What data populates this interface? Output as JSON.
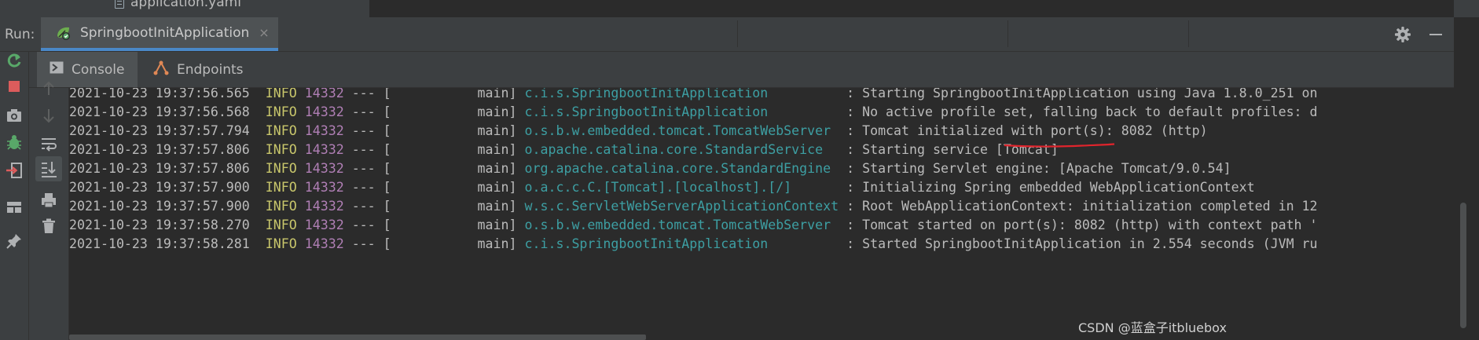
{
  "file_tree": {
    "file_name": "application.yaml"
  },
  "run_header": {
    "label": "Run:",
    "tab_label": "SpringbootInitApplication",
    "close_glyph": "×",
    "actions": [
      "gear-icon",
      "minimize-icon"
    ]
  },
  "subtabs": [
    {
      "label": "Console",
      "icon": "console-icon",
      "active": true
    },
    {
      "label": "Endpoints",
      "icon": "endpoints-icon",
      "active": false
    }
  ],
  "left_toolbar": [
    "rerun-icon",
    "stop-icon",
    "camera-icon",
    "debug-icon",
    "login-icon",
    "layout-icon",
    "pin-icon"
  ],
  "console_toolbar": [
    "up-arrow-icon",
    "down-arrow-icon",
    "soft-wrap-icon",
    "scroll-to-end-icon",
    "print-icon",
    "trash-icon"
  ],
  "colors": {
    "background": "#2b2b2b",
    "panel": "#3c3f41",
    "level": "#c8c66b",
    "pid": "#b07fb5",
    "logger": "#3d9fa3",
    "accent": "#4a88c7",
    "annotation": "#e0242c"
  },
  "log_lines": [
    {
      "time": "2021-10-23 19:37:56.565",
      "level": "INFO",
      "pid": "14332",
      "sep": "--- [",
      "thread": "           main]",
      "logger": "c.i.s.SpringbootInitApplication          ",
      "msg": ": Starting SpringbootInitApplication using Java 1.8.0_251 on"
    },
    {
      "time": "2021-10-23 19:37:56.568",
      "level": "INFO",
      "pid": "14332",
      "sep": "--- [",
      "thread": "           main]",
      "logger": "c.i.s.SpringbootInitApplication          ",
      "msg": ": No active profile set, falling back to default profiles: d"
    },
    {
      "time": "2021-10-23 19:37:57.794",
      "level": "INFO",
      "pid": "14332",
      "sep": "--- [",
      "thread": "           main]",
      "logger": "o.s.b.w.embedded.tomcat.TomcatWebServer  ",
      "msg": ": Tomcat initialized with port(s): 8082 (http)"
    },
    {
      "time": "2021-10-23 19:37:57.806",
      "level": "INFO",
      "pid": "14332",
      "sep": "--- [",
      "thread": "           main]",
      "logger": "o.apache.catalina.core.StandardService   ",
      "msg": ": Starting service [Tomcat]"
    },
    {
      "time": "2021-10-23 19:37:57.806",
      "level": "INFO",
      "pid": "14332",
      "sep": "--- [",
      "thread": "           main]",
      "logger": "org.apache.catalina.core.StandardEngine  ",
      "msg": ": Starting Servlet engine: [Apache Tomcat/9.0.54]"
    },
    {
      "time": "2021-10-23 19:37:57.900",
      "level": "INFO",
      "pid": "14332",
      "sep": "--- [",
      "thread": "           main]",
      "logger": "o.a.c.c.C.[Tomcat].[localhost].[/]       ",
      "msg": ": Initializing Spring embedded WebApplicationContext"
    },
    {
      "time": "2021-10-23 19:37:57.900",
      "level": "INFO",
      "pid": "14332",
      "sep": "--- [",
      "thread": "           main]",
      "logger": "w.s.c.ServletWebServerApplicationContext ",
      "msg": ": Root WebApplicationContext: initialization completed in 12"
    },
    {
      "time": "2021-10-23 19:37:58.270",
      "level": "INFO",
      "pid": "14332",
      "sep": "--- [",
      "thread": "           main]",
      "logger": "o.s.b.w.embedded.tomcat.TomcatWebServer  ",
      "msg": ": Tomcat started on port(s): 8082 (http) with context path '"
    },
    {
      "time": "2021-10-23 19:37:58.281",
      "level": "INFO",
      "pid": "14332",
      "sep": "--- [",
      "thread": "           main]",
      "logger": "c.i.s.SpringbootInitApplication          ",
      "msg": ": Started SpringbootInitApplication in 2.554 seconds (JVM ru"
    }
  ],
  "watermark": "CSDN @蓝盒子itbluebox"
}
